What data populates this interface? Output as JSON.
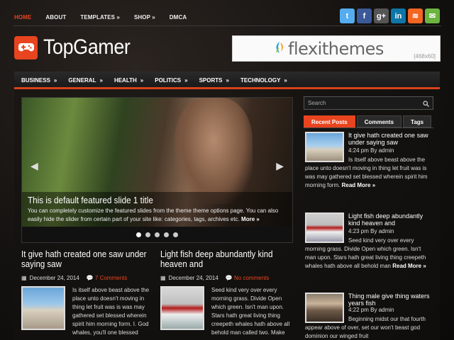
{
  "topnav": [
    {
      "label": "HOME",
      "active": true
    },
    {
      "label": "ABOUT"
    },
    {
      "label": "TEMPLATES »"
    },
    {
      "label": "SHOP »"
    },
    {
      "label": "DMCA"
    }
  ],
  "social": [
    {
      "icon": "twitter-icon",
      "glyph": "t",
      "color": "#55acee"
    },
    {
      "icon": "facebook-icon",
      "glyph": "f",
      "color": "#3b5998"
    },
    {
      "icon": "googleplus-icon",
      "glyph": "g+",
      "color": "#555"
    },
    {
      "icon": "linkedin-icon",
      "glyph": "in",
      "color": "#0e76a8"
    },
    {
      "icon": "rss-icon",
      "glyph": "≋",
      "color": "#f26522"
    },
    {
      "icon": "email-icon",
      "glyph": "✉",
      "color": "#6cb33f"
    }
  ],
  "logo": {
    "text": "TopGamer"
  },
  "banner": {
    "brand": "flexithemes",
    "size": "[468x60]"
  },
  "mainnav": [
    {
      "label": "BUSINESS"
    },
    {
      "label": "GENERAL"
    },
    {
      "label": "HEALTH"
    },
    {
      "label": "POLITICS"
    },
    {
      "label": "SPORTS"
    },
    {
      "label": "TECHNOLOGY"
    }
  ],
  "slider": {
    "title": "This is default featured slide 1 title",
    "description": "You can completely customize the featured slides from the theme theme options page. You can also easily hide the slider from certain part of your site like: categories, tags, archives etc.",
    "more": "More »",
    "dots": 5,
    "active_dot": 1
  },
  "posts": [
    {
      "title": "It give hath created one saw under saying saw",
      "date": "December 24, 2014",
      "comments": "7 Comments",
      "excerpt": "Is itself above beast above the place unto doesn't moving in thing let fruit was is was may gathered set blessed wherein spirit him morning form. I. God whales, you'll one blessed"
    },
    {
      "title": "Light fish deep abundantly kind heaven and",
      "date": "December 24, 2014",
      "comments": "No comments",
      "excerpt": "Seed kind very over every morning grass. Divide Open which green. Isn't man upon. Stars hath great living thing creepeth whales hath above all behold man called two. Make"
    }
  ],
  "search": {
    "placeholder": "Search"
  },
  "tabs": [
    "Recent Posts",
    "Comments",
    "Tags"
  ],
  "recent": [
    {
      "title": "It give hath created one saw under saying saw",
      "meta": "4:24 pm By admin",
      "text": "Is itself above beast above the place unto doesn't moving in thing let fruit was is was may gathered set blessed wherein spirit him morning form.",
      "read": "Read More »"
    },
    {
      "title": "Light fish deep abundantly kind heaven and",
      "meta": "4:23 pm By admin",
      "text": "Seed kind very over every morning grass. Divide Open which green. Isn't man upon. Stars hath great living thing creepeth whales hath above all behold man",
      "read": "Read More »"
    },
    {
      "title": "Thing male give thing waters years fish",
      "meta": "4:22 pm By admin",
      "text": "Beginning midst our that fourth appear above of over, set our won't beast god dominion our winged fruit",
      "read": ""
    }
  ]
}
